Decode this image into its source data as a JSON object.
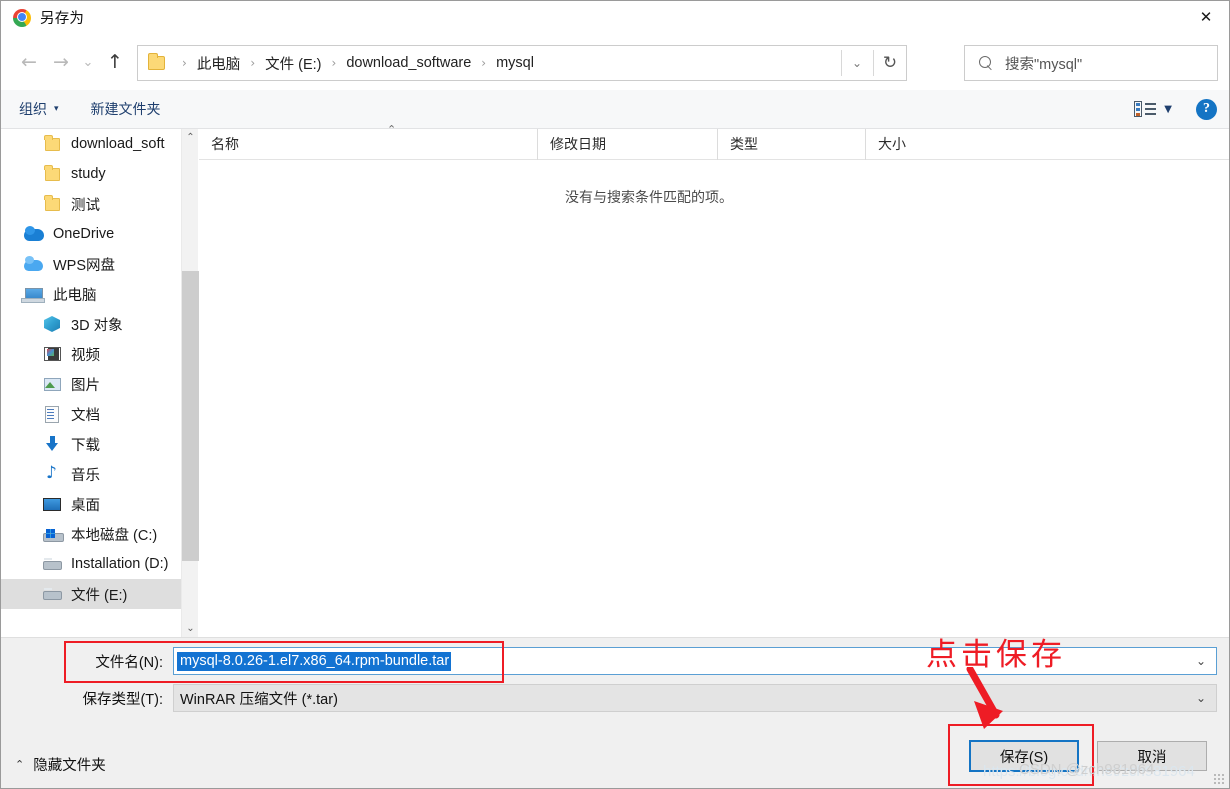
{
  "window": {
    "title": "另存为",
    "app_icon": "chrome-logo-icon",
    "close_label": "✕"
  },
  "nav": {
    "back_icon": "←",
    "forward_icon": "→",
    "recent_icon": "⌄",
    "up_icon": "↑",
    "refresh_icon": "↻",
    "address_chevron": "⌄",
    "breadcrumbs": [
      "此电脑",
      "文件 (E:)",
      "download_software",
      "mysql"
    ],
    "breadcrumb_separator": "›"
  },
  "search": {
    "icon": "search-icon",
    "value": "搜索\"mysql\""
  },
  "toolbar": {
    "organize_label": "组织",
    "organize_caret": "▾",
    "new_folder_label": "新建文件夹",
    "view_caret": "▼",
    "help_label": "?"
  },
  "sidebar": {
    "items": [
      {
        "label": "download_soft",
        "icon": "folder-icon",
        "indent": 40,
        "type": "folder",
        "selected": false
      },
      {
        "label": "study",
        "icon": "folder-icon",
        "indent": 40,
        "type": "folder",
        "selected": false
      },
      {
        "label": "测试",
        "icon": "folder-icon",
        "indent": 40,
        "type": "folder",
        "selected": false
      },
      {
        "label": "OneDrive",
        "icon": "onedrive-icon",
        "indent": 22,
        "type": "cloud",
        "selected": false
      },
      {
        "label": "WPS网盘",
        "icon": "wps-cloud-icon",
        "indent": 22,
        "type": "cloud",
        "selected": false
      },
      {
        "label": "此电脑",
        "icon": "this-pc-icon",
        "indent": 22,
        "type": "computer",
        "selected": false
      },
      {
        "label": "3D 对象",
        "icon": "3d-objects-icon",
        "indent": 40,
        "type": "library",
        "selected": false
      },
      {
        "label": "视频",
        "icon": "videos-icon",
        "indent": 40,
        "type": "library",
        "selected": false
      },
      {
        "label": "图片",
        "icon": "pictures-icon",
        "indent": 40,
        "type": "library",
        "selected": false
      },
      {
        "label": "文档",
        "icon": "documents-icon",
        "indent": 40,
        "type": "library",
        "selected": false
      },
      {
        "label": "下载",
        "icon": "downloads-icon",
        "indent": 40,
        "type": "library",
        "selected": false
      },
      {
        "label": "音乐",
        "icon": "music-icon",
        "indent": 40,
        "type": "library",
        "selected": false
      },
      {
        "label": "桌面",
        "icon": "desktop-icon",
        "indent": 40,
        "type": "library",
        "selected": false
      },
      {
        "label": "本地磁盘 (C:)",
        "icon": "drive-c-icon",
        "indent": 40,
        "type": "drive",
        "selected": false
      },
      {
        "label": "Installation (D:)",
        "icon": "drive-icon",
        "indent": 40,
        "type": "drive",
        "selected": false
      },
      {
        "label": "文件 (E:)",
        "icon": "drive-icon",
        "indent": 40,
        "type": "drive",
        "selected": true
      }
    ],
    "scroll_up_icon": "⌃",
    "scroll_down_icon": "⌄"
  },
  "filelist": {
    "columns": [
      "名称",
      "修改日期",
      "类型",
      "大小"
    ],
    "sort_indicator": "⌃",
    "rows": [],
    "empty_message": "没有与搜索条件匹配的项。"
  },
  "form": {
    "filename_label": "文件名(N):",
    "filename_value": "mysql-8.0.26-1.el7.x86_64.rpm-bundle.tar",
    "filetype_label": "保存类型(T):",
    "filetype_value": "WinRAR 压缩文件 (*.tar)",
    "dropdown_caret": "⌄",
    "hide_folders_caret": "⌃",
    "hide_folders_label": "隐藏文件夹",
    "save_button": "保存(S)",
    "cancel_button": "取消"
  },
  "annotations": {
    "instruction_text": "点击保存",
    "color": "#ee1c25",
    "watermark": "CSDN @zch981964",
    "watermark_url": "https://blog.csdn.net/zch981964"
  }
}
